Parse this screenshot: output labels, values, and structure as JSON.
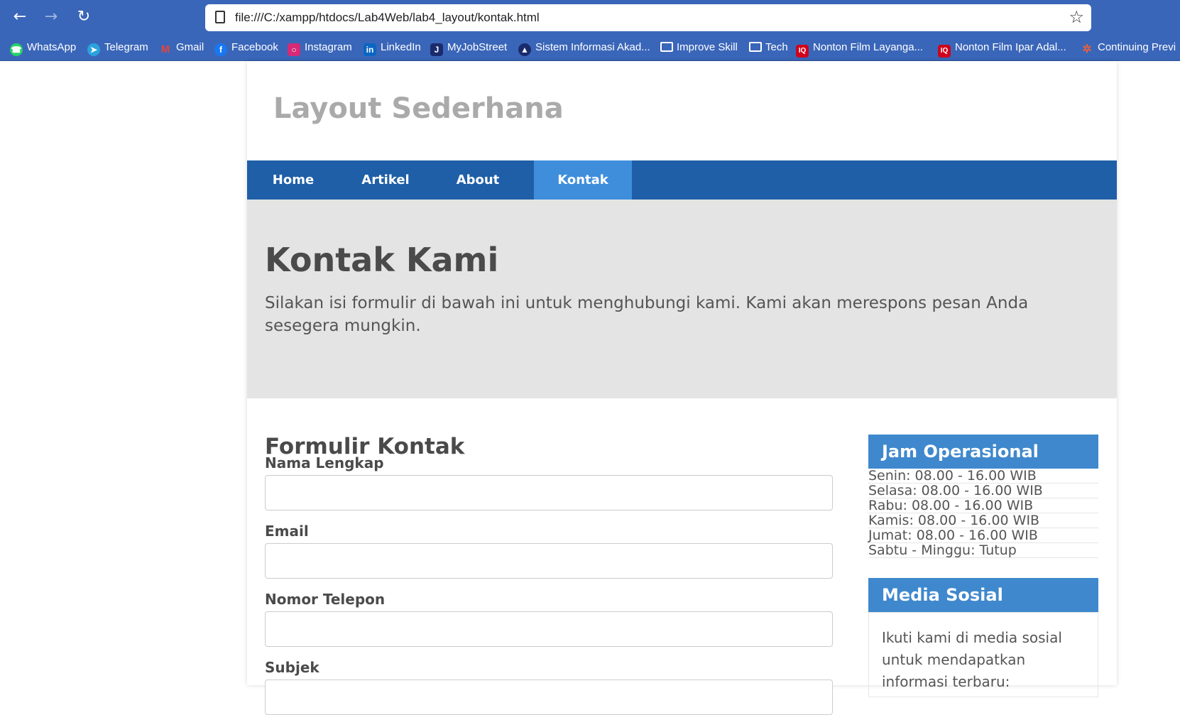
{
  "browser": {
    "url": "file:///C:/xampp/htdocs/Lab4Web/lab4_layout/kontak.html",
    "bookmarks": [
      {
        "label": "WhatsApp",
        "icon": "whatsapp-icon",
        "color": "#25d366"
      },
      {
        "label": "Telegram",
        "icon": "telegram-icon",
        "color": "#2aa3de"
      },
      {
        "label": "Gmail",
        "icon": "gmail-icon",
        "color": "#ea4335"
      },
      {
        "label": "Facebook",
        "icon": "facebook-icon",
        "color": "#1877f2"
      },
      {
        "label": "Instagram",
        "icon": "instagram-icon",
        "color": "#d62976"
      },
      {
        "label": "LinkedIn",
        "icon": "linkedin-icon",
        "color": "#0a66c2"
      },
      {
        "label": "MyJobStreet",
        "icon": "jobstreet-icon",
        "color": "#1a2b6d"
      },
      {
        "label": "Sistem Informasi Akad...",
        "icon": "university-icon",
        "color": "#1a2b6d"
      },
      {
        "label": "Improve Skill",
        "icon": "folder-icon"
      },
      {
        "label": "Tech",
        "icon": "folder-icon"
      },
      {
        "label": "Nonton Film Layanga...",
        "icon": "iq-icon",
        "color": "#d0021b"
      },
      {
        "label": "Nonton Film Ipar Adal...",
        "icon": "iq-icon",
        "color": "#d0021b"
      },
      {
        "label": "Continuing Previ",
        "icon": "sparkle-icon",
        "color": "#e06040"
      }
    ]
  },
  "site": {
    "title": "Layout Sederhana",
    "nav": [
      "Home",
      "Artikel",
      "About",
      "Kontak"
    ],
    "active_nav": "Kontak",
    "accent": "#1f5fa8",
    "active_color": "#3f8edc"
  },
  "hero": {
    "heading": "Kontak Kami",
    "text": "Silakan isi formulir di bawah ini untuk menghubungi kami. Kami akan merespons pesan Anda sesegera mungkin."
  },
  "form": {
    "title": "Formulir Kontak",
    "fields": [
      "Nama Lengkap",
      "Email",
      "Nomor Telepon",
      "Subjek"
    ]
  },
  "sidebar": {
    "hours_title": "Jam Operasional",
    "hours": [
      "Senin: 08.00 - 16.00 WIB",
      "Selasa: 08.00 - 16.00 WIB",
      "Rabu: 08.00 - 16.00 WIB",
      "Kamis: 08.00 - 16.00 WIB",
      "Jumat: 08.00 - 16.00 WIB",
      "Sabtu - Minggu: Tutup"
    ],
    "media_title": "Media Sosial",
    "media_text": "Ikuti kami di media sosial untuk mendapatkan informasi terbaru:"
  }
}
